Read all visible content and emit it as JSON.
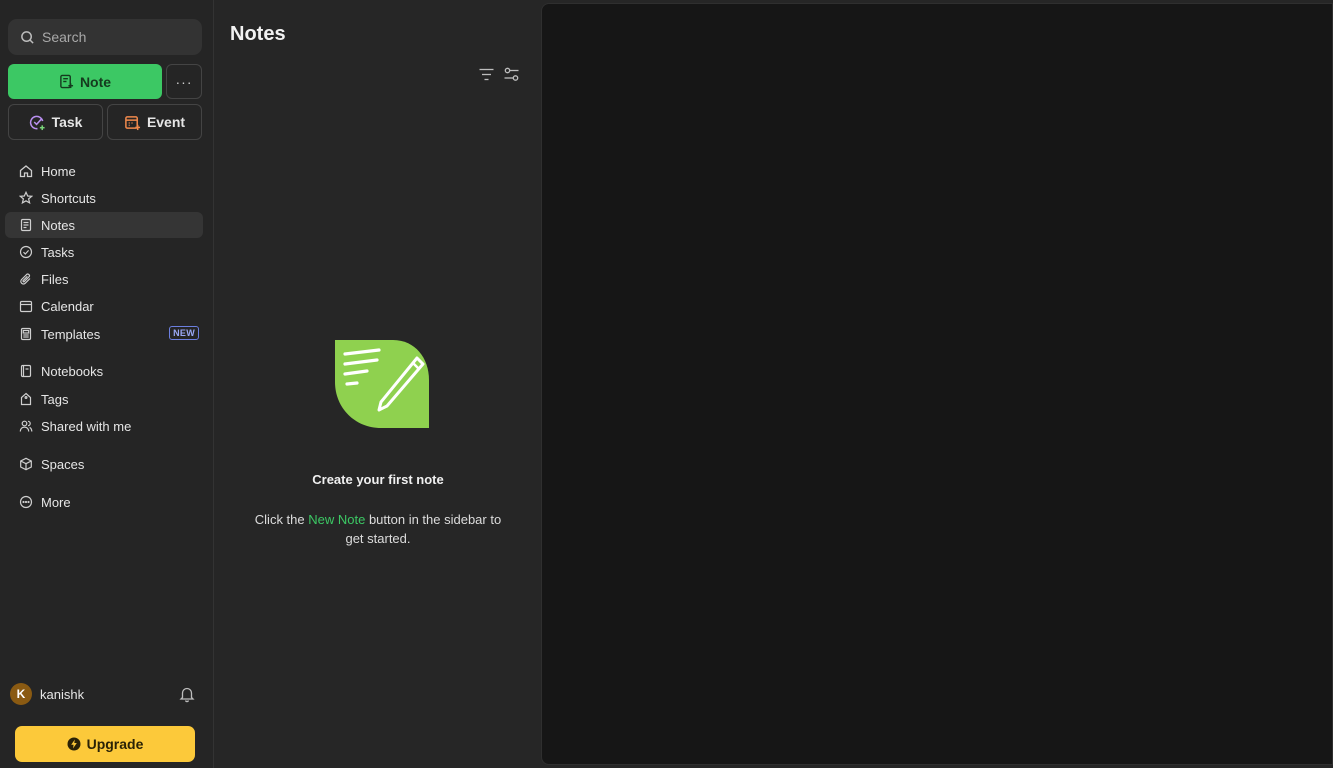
{
  "sidebar": {
    "search_placeholder": "Search",
    "note_button": "Note",
    "more_button": "···",
    "task_button": "Task",
    "event_button": "Event",
    "nav": [
      {
        "label": "Home",
        "icon": "home-icon"
      },
      {
        "label": "Shortcuts",
        "icon": "star-icon"
      },
      {
        "label": "Notes",
        "icon": "note-icon",
        "active": true
      },
      {
        "label": "Tasks",
        "icon": "check-circle-icon"
      },
      {
        "label": "Files",
        "icon": "paperclip-icon"
      },
      {
        "label": "Calendar",
        "icon": "calendar-icon"
      },
      {
        "label": "Templates",
        "icon": "template-icon",
        "badge": "NEW"
      },
      {
        "label": "Notebooks",
        "icon": "notebook-icon"
      },
      {
        "label": "Tags",
        "icon": "tag-icon"
      },
      {
        "label": "Shared with me",
        "icon": "people-icon"
      },
      {
        "label": "Spaces",
        "icon": "cube-icon"
      },
      {
        "label": "More",
        "icon": "more-circle-icon"
      }
    ],
    "user": {
      "initial": "K",
      "name": "kanishk"
    },
    "upgrade_button": "Upgrade"
  },
  "notes_panel": {
    "title": "Notes",
    "empty_title": "Create your first note",
    "empty_desc_before": "Click the ",
    "empty_desc_highlight": "New Note",
    "empty_desc_after": " button in the sidebar to get started."
  },
  "colors": {
    "accent_green": "#3cc864",
    "upgrade_yellow": "#fcc93a",
    "badge_blue": "#6c7fe0",
    "illustration_green": "#8fd14f"
  }
}
